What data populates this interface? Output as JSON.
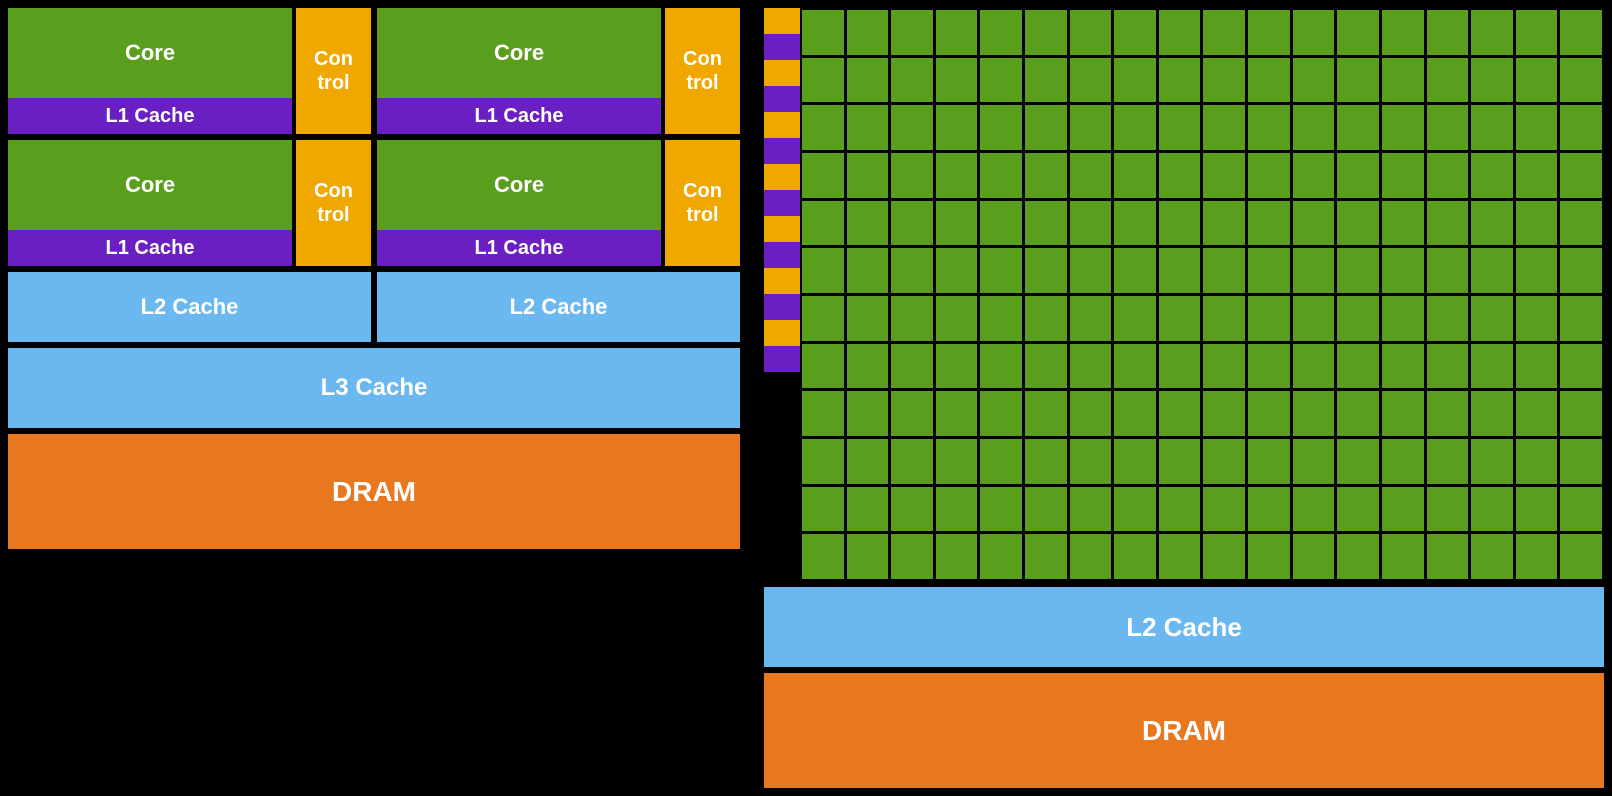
{
  "left": {
    "core1_label": "Core",
    "control1_label": "Con\ntrol",
    "l1_cache1_label": "L1 Cache",
    "core2_label": "Core",
    "control2_label": "Con\ntrol",
    "l1_cache2_label": "L1 Cache",
    "core3_label": "Core",
    "control3_label": "Con\ntrol",
    "l1_cache3_label": "L1 Cache",
    "core4_label": "Core",
    "control4_label": "Con\ntrol",
    "l1_cache4_label": "L1 Cache",
    "l2_cache1_label": "L2 Cache",
    "l2_cache2_label": "L2 Cache",
    "l3_cache_label": "L3 Cache",
    "dram_label": "DRAM"
  },
  "right": {
    "l2_cache_label": "L2 Cache",
    "dram_label": "DRAM",
    "grid_cols": 18,
    "grid_rows": 12,
    "stripe_colors": [
      "#f0a800",
      "#6a1fc2"
    ],
    "stripe_count": 14
  }
}
